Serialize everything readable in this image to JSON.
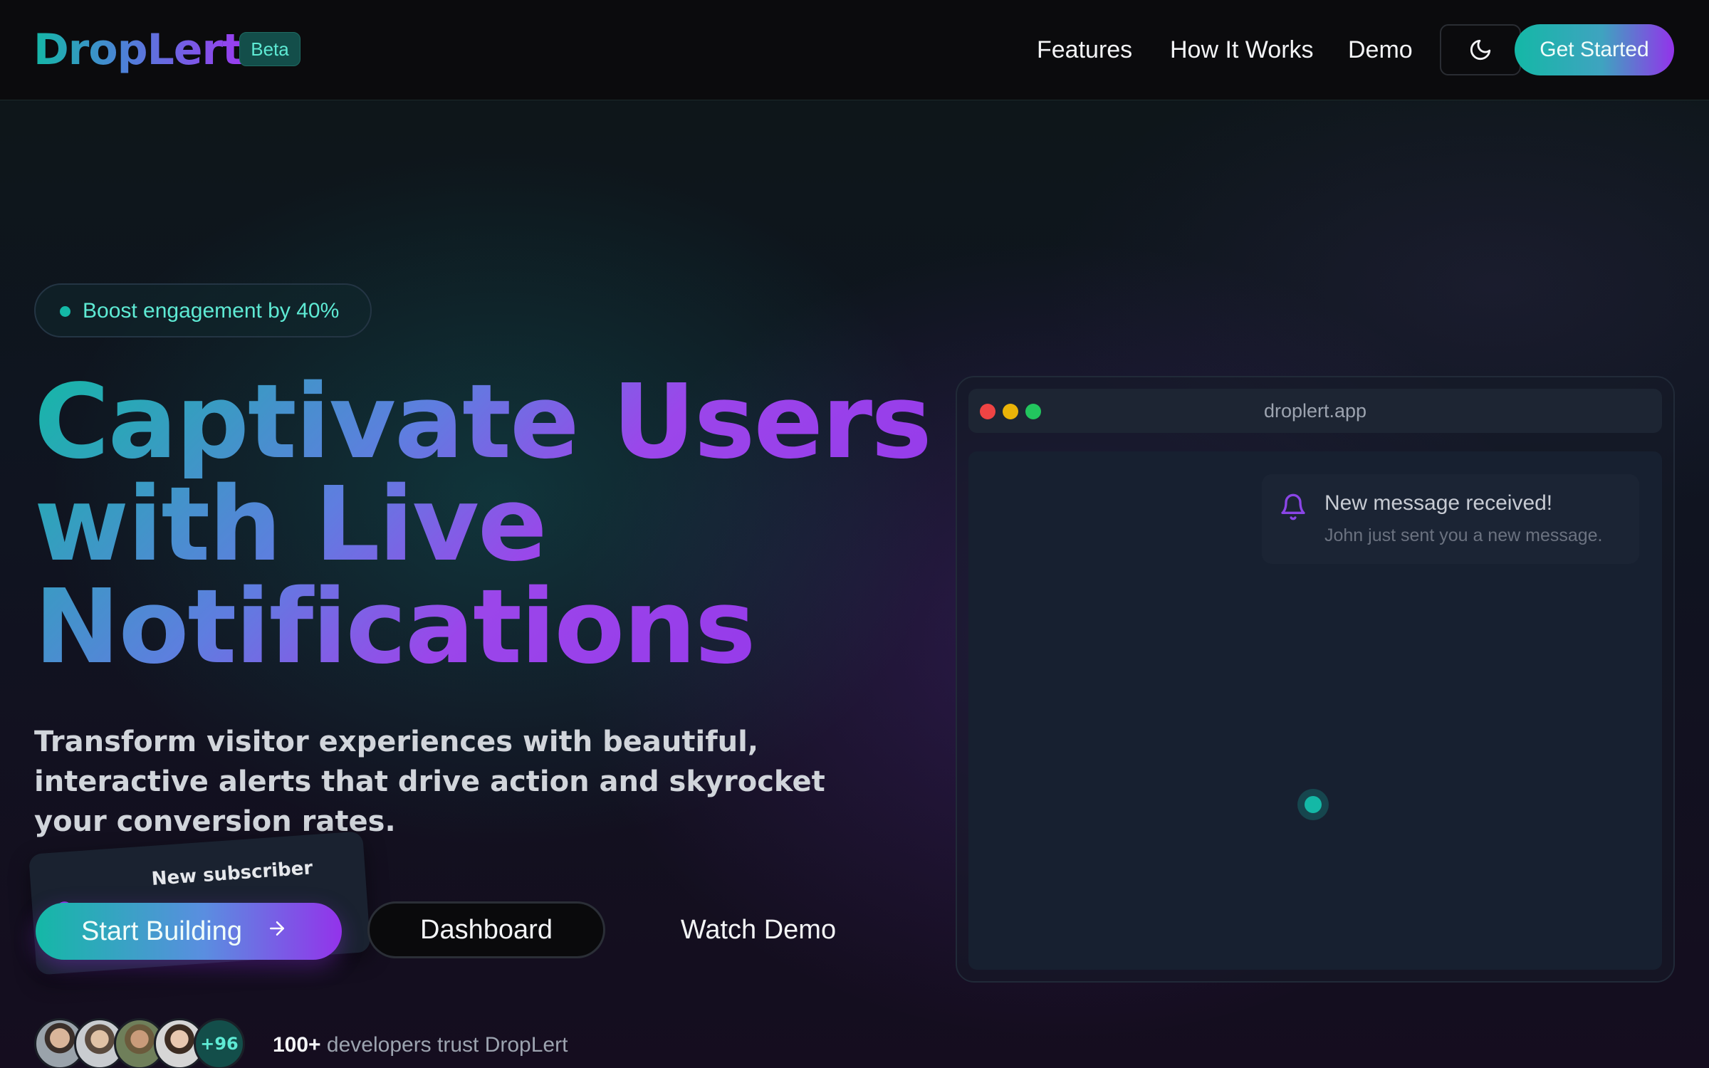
{
  "brand": {
    "name": "DropLert",
    "badge": "Beta"
  },
  "nav": {
    "links": [
      "Features",
      "How It Works",
      "Demo"
    ],
    "theme_icon": "moon-icon",
    "cta": "Get Started"
  },
  "hero": {
    "pill": "Boost engagement by 40%",
    "headline_line1": "Captivate Users",
    "headline_line2": "with Live",
    "headline_line3": "Notifications",
    "subtext": "Transform visitor experiences with beautiful, interactive alerts that drive action and skyrocket your conversion rates.",
    "floating_card": {
      "title": "New subscriber",
      "icon": "bell-icon"
    },
    "buttons": {
      "start": "Start Building",
      "start_icon": "arrow-right-icon",
      "dashboard": "Dashboard",
      "watch": "Watch Demo"
    },
    "social_proof": {
      "more_count": "+96",
      "count": "100+",
      "text": "developers trust DropLert"
    }
  },
  "mockup": {
    "url": "droplert.app",
    "notification": {
      "title": "New message received!",
      "body": "John just sent you a new message.",
      "icon": "bell-icon"
    }
  },
  "colors": {
    "accent_teal": "#14b8a6",
    "accent_purple": "#9333ea",
    "window_red": "#ef4444",
    "window_yellow": "#eab308",
    "window_green": "#22c55e"
  }
}
